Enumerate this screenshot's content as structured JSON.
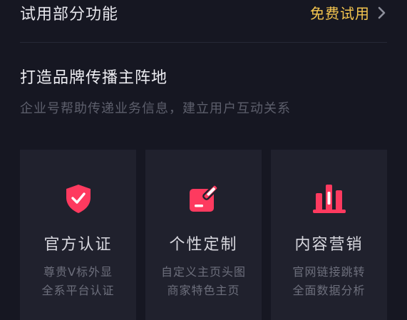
{
  "trial": {
    "title": "试用部分功能",
    "cta": "免费试用",
    "chevron_icon": "chevron-right-icon"
  },
  "section": {
    "title": "打造品牌传播主阵地",
    "subtitle": "企业号帮助传递业务信息，建立用户互动关系"
  },
  "colors": {
    "background": "#161722",
    "card_background": "#20212d",
    "accent_pink": "#fe3a5f",
    "cta_yellow": "#f4c54f",
    "muted_text": "#5d5f6c"
  },
  "features": [
    {
      "icon": "shield-check-icon",
      "title": "官方认证",
      "desc_line1": "尊贵V标外显",
      "desc_line2": "全系平台认证"
    },
    {
      "icon": "edit-customize-icon",
      "title": "个性定制",
      "desc_line1": "自定义主页头图",
      "desc_line2": "商家特色主页"
    },
    {
      "icon": "bar-chart-icon",
      "title": "内容营销",
      "desc_line1": "官网链接跳转",
      "desc_line2": "全面数据分析"
    }
  ]
}
